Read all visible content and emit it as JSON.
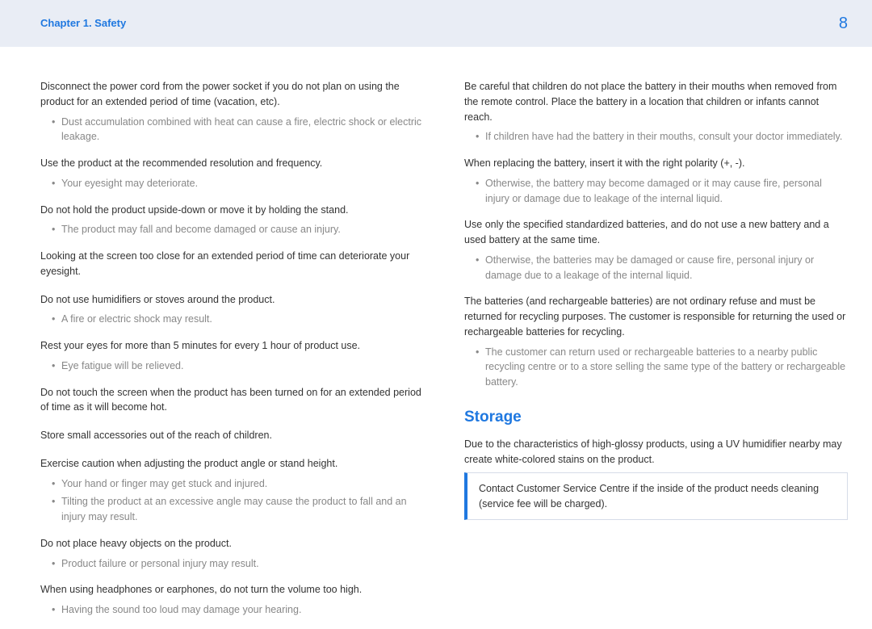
{
  "header": {
    "chapter": "Chapter 1. Safety",
    "page": "8"
  },
  "left": [
    {
      "para": "Disconnect the power cord from the power socket if you do not plan on using the product for an extended period of time (vacation, etc).",
      "bullets": [
        "Dust accumulation combined with heat can cause a fire, electric shock or electric leakage."
      ]
    },
    {
      "para": "Use the product at the recommended resolution and frequency.",
      "bullets": [
        "Your eyesight may deteriorate."
      ]
    },
    {
      "para": "Do not hold the product upside-down or move it by holding the stand.",
      "bullets": [
        "The product may fall and become damaged or cause an injury."
      ]
    },
    {
      "para": "Looking at the screen too close for an extended period of time can deteriorate your eyesight.",
      "bullets": []
    },
    {
      "para": "Do not use humidifiers or stoves around the product.",
      "bullets": [
        "A fire or electric shock may result."
      ]
    },
    {
      "para": "Rest your eyes for more than 5 minutes for every 1 hour of product use.",
      "bullets": [
        "Eye fatigue will be relieved."
      ]
    },
    {
      "para": "Do not touch the screen when the product has been turned on for an extended period of time as it will become hot.",
      "bullets": []
    },
    {
      "para": "Store small accessories out of the reach of children.",
      "bullets": []
    },
    {
      "para": "Exercise caution when adjusting the product angle or stand height.",
      "bullets": [
        "Your hand or finger may get stuck and injured.",
        "Tilting the product at an excessive angle may cause the product to fall and an injury may result."
      ]
    },
    {
      "para": "Do not place heavy objects on the product.",
      "bullets": [
        "Product failure or personal injury may result."
      ]
    },
    {
      "para": "When using headphones or earphones, do not turn the volume too high.",
      "bullets": [
        "Having the sound too loud may damage your hearing."
      ]
    }
  ],
  "right": [
    {
      "para": "Be careful that children do not place the battery in their mouths when removed from the remote control. Place the battery in a location that children or infants cannot reach.",
      "bullets": [
        "If children have had the battery in their mouths, consult your doctor immediately."
      ]
    },
    {
      "para": "When replacing the battery, insert it with the right polarity (+, -).",
      "bullets": [
        "Otherwise, the battery may become damaged or it may cause fire, personal injury or damage due to leakage of the internal liquid."
      ]
    },
    {
      "para": "Use only the specified standardized batteries, and do not use a new battery and a used battery at the same time.",
      "bullets": [
        "Otherwise, the batteries may be damaged or cause fire, personal injury or damage due to a leakage of the internal liquid."
      ]
    },
    {
      "para": "The batteries (and rechargeable batteries) are not ordinary refuse and must be returned for recycling purposes. The customer is responsible for returning the used or rechargeable batteries for recycling.",
      "bullets": [
        "The customer can return used or rechargeable batteries to a nearby public recycling centre or to a store selling the same type of the battery or rechargeable battery."
      ]
    }
  ],
  "storage": {
    "heading": "Storage",
    "para": "Due to the characteristics of high-glossy products, using a UV humidifier nearby may create white-colored stains on the product.",
    "note": "Contact Customer Service Centre if the inside of the product needs cleaning (service fee will be charged)."
  }
}
